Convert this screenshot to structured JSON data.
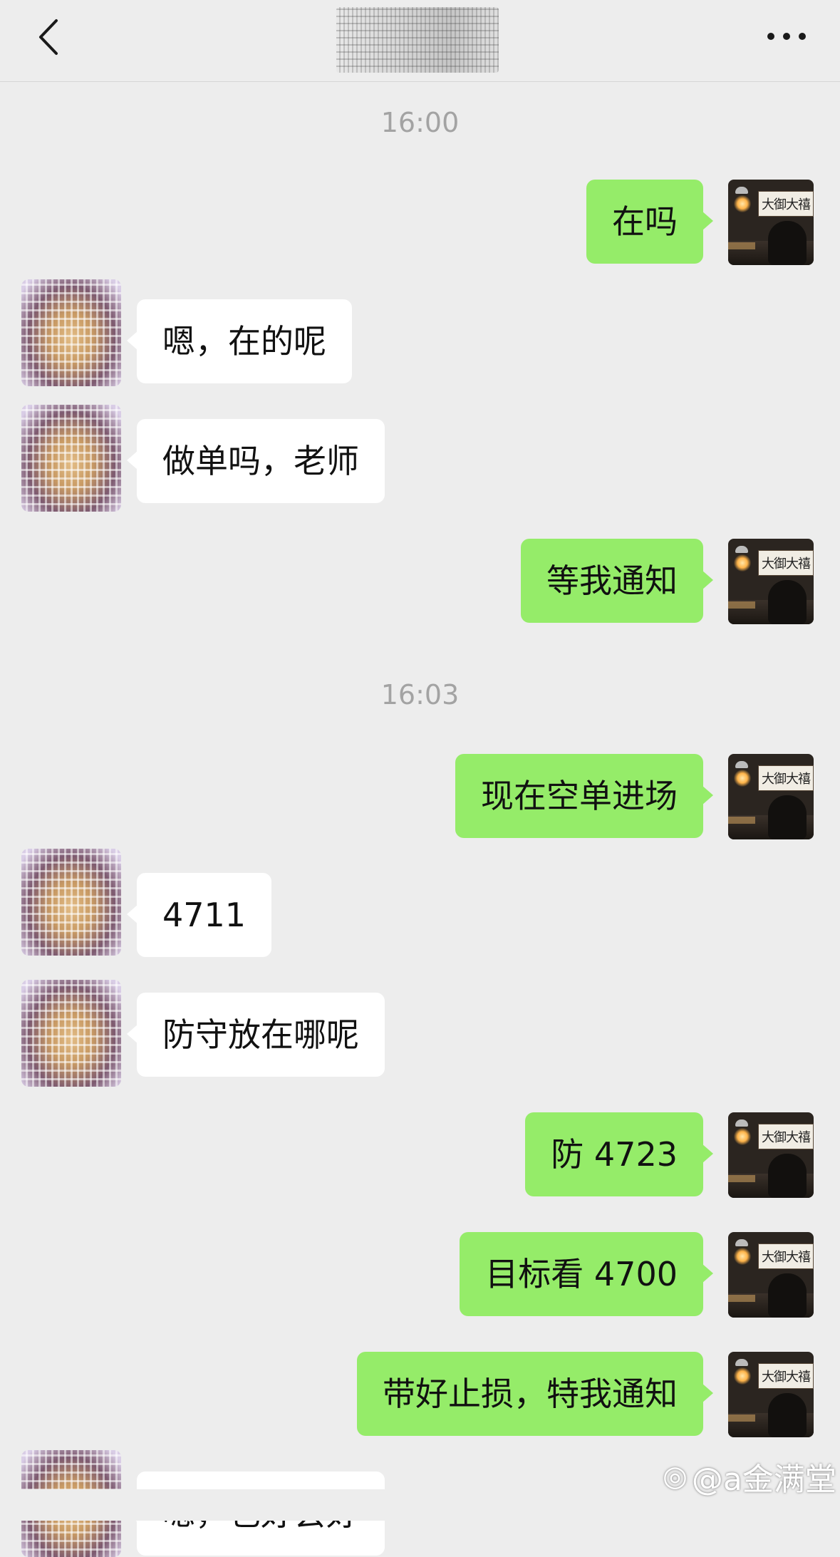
{
  "header": {
    "title": ""
  },
  "messages": {
    "time1": "16:00",
    "m1": "在吗",
    "m2": "嗯，在的呢",
    "m3": "做单吗，老师",
    "m4": "等我通知",
    "time2": "16:03",
    "m5": "现在空单进场",
    "m6": "4711",
    "m7": "防守放在哪呢",
    "m8": "防 4723",
    "m9": "目标看 4700",
    "m10": "带好止损，特我通知",
    "m11": "嗯，也好会好"
  },
  "my_avatar_sign": "大御大禧",
  "watermark": "@a金满堂",
  "colors": {
    "my_bubble": "#95ec69",
    "other_bubble": "#ffffff",
    "background": "#ededed",
    "time": "#a3a3a3"
  },
  "icons": [
    "back-arrow-icon",
    "more-dots-icon",
    "weibo-icon"
  ]
}
